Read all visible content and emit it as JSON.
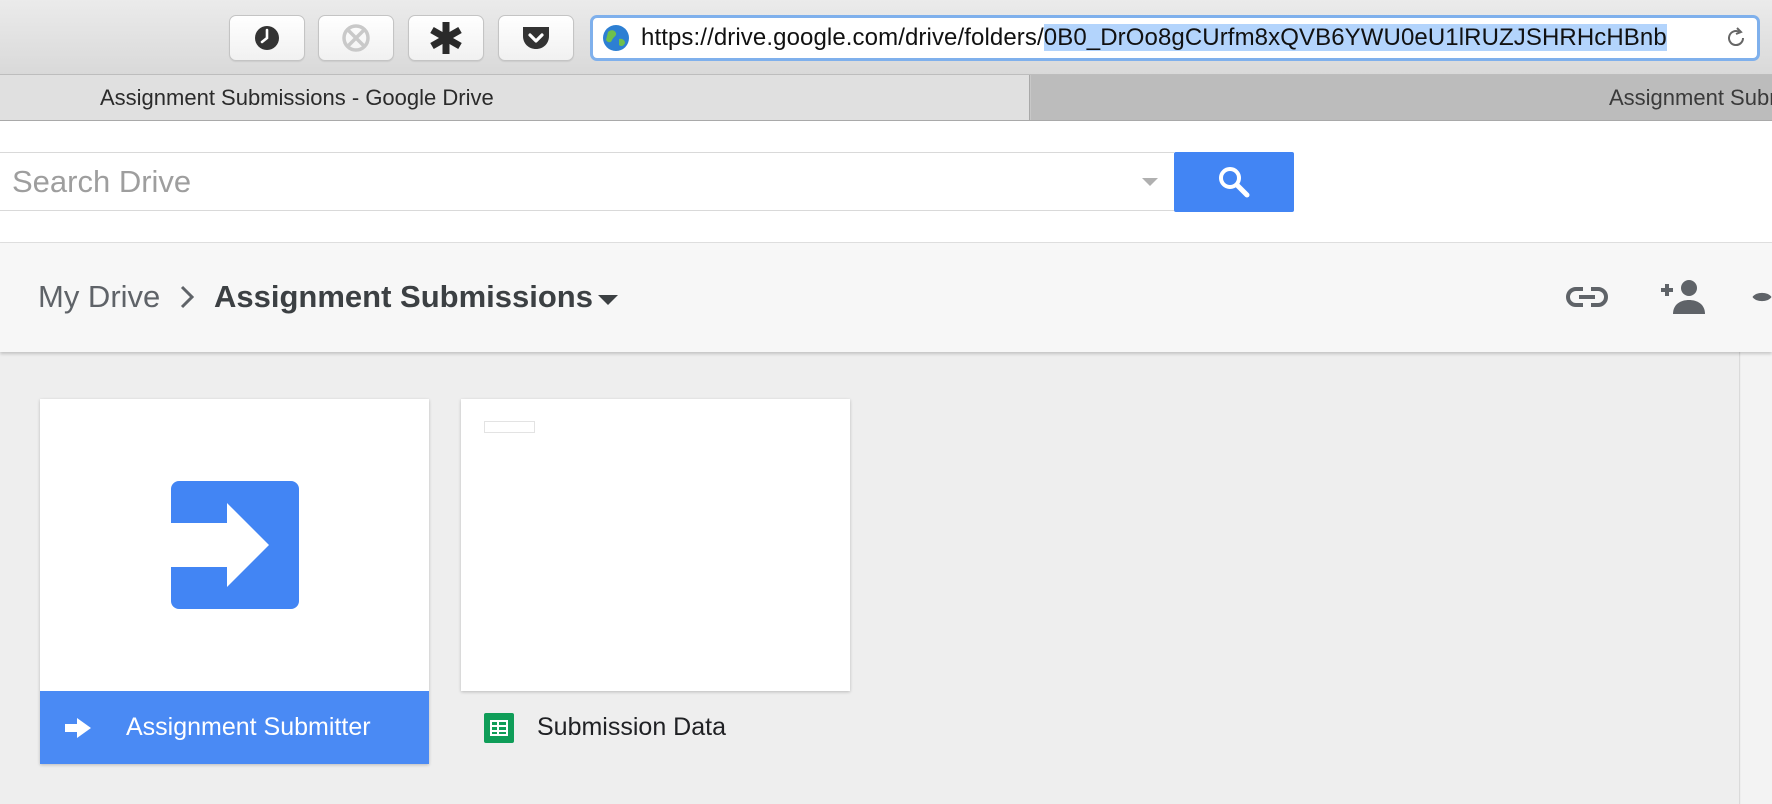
{
  "browser": {
    "url_prefix": "https://drive.google.com/drive/folders/",
    "url_selected": "0B0_DrOo8gCUrfm8xQVB6YWU0eU1lRUZJSHRHcHBnb",
    "toolbar_buttons": [
      "history-icon",
      "blocked-icon",
      "asterisk-icon",
      "pocket-icon"
    ]
  },
  "tabs": [
    {
      "label": "Assignment Submissions - Google Drive",
      "active": true
    },
    {
      "label": "Assignment Submissions",
      "active": false
    }
  ],
  "search": {
    "placeholder": "Search Drive"
  },
  "breadcrumb": {
    "root": "My Drive",
    "current": "Assignment Submissions"
  },
  "header_actions": [
    "link-icon",
    "add-person-icon",
    "preview-icon"
  ],
  "items": [
    {
      "name": "Assignment Submitter",
      "type": "form",
      "selected": true,
      "icon": "arrow-right-icon"
    },
    {
      "name": "Submission Data",
      "type": "spreadsheet",
      "selected": false,
      "icon": "sheets-icon"
    }
  ],
  "colors": {
    "accent_blue": "#4285f4",
    "selected_label": "#4a8af4",
    "sheets_green": "#0f9d58"
  }
}
